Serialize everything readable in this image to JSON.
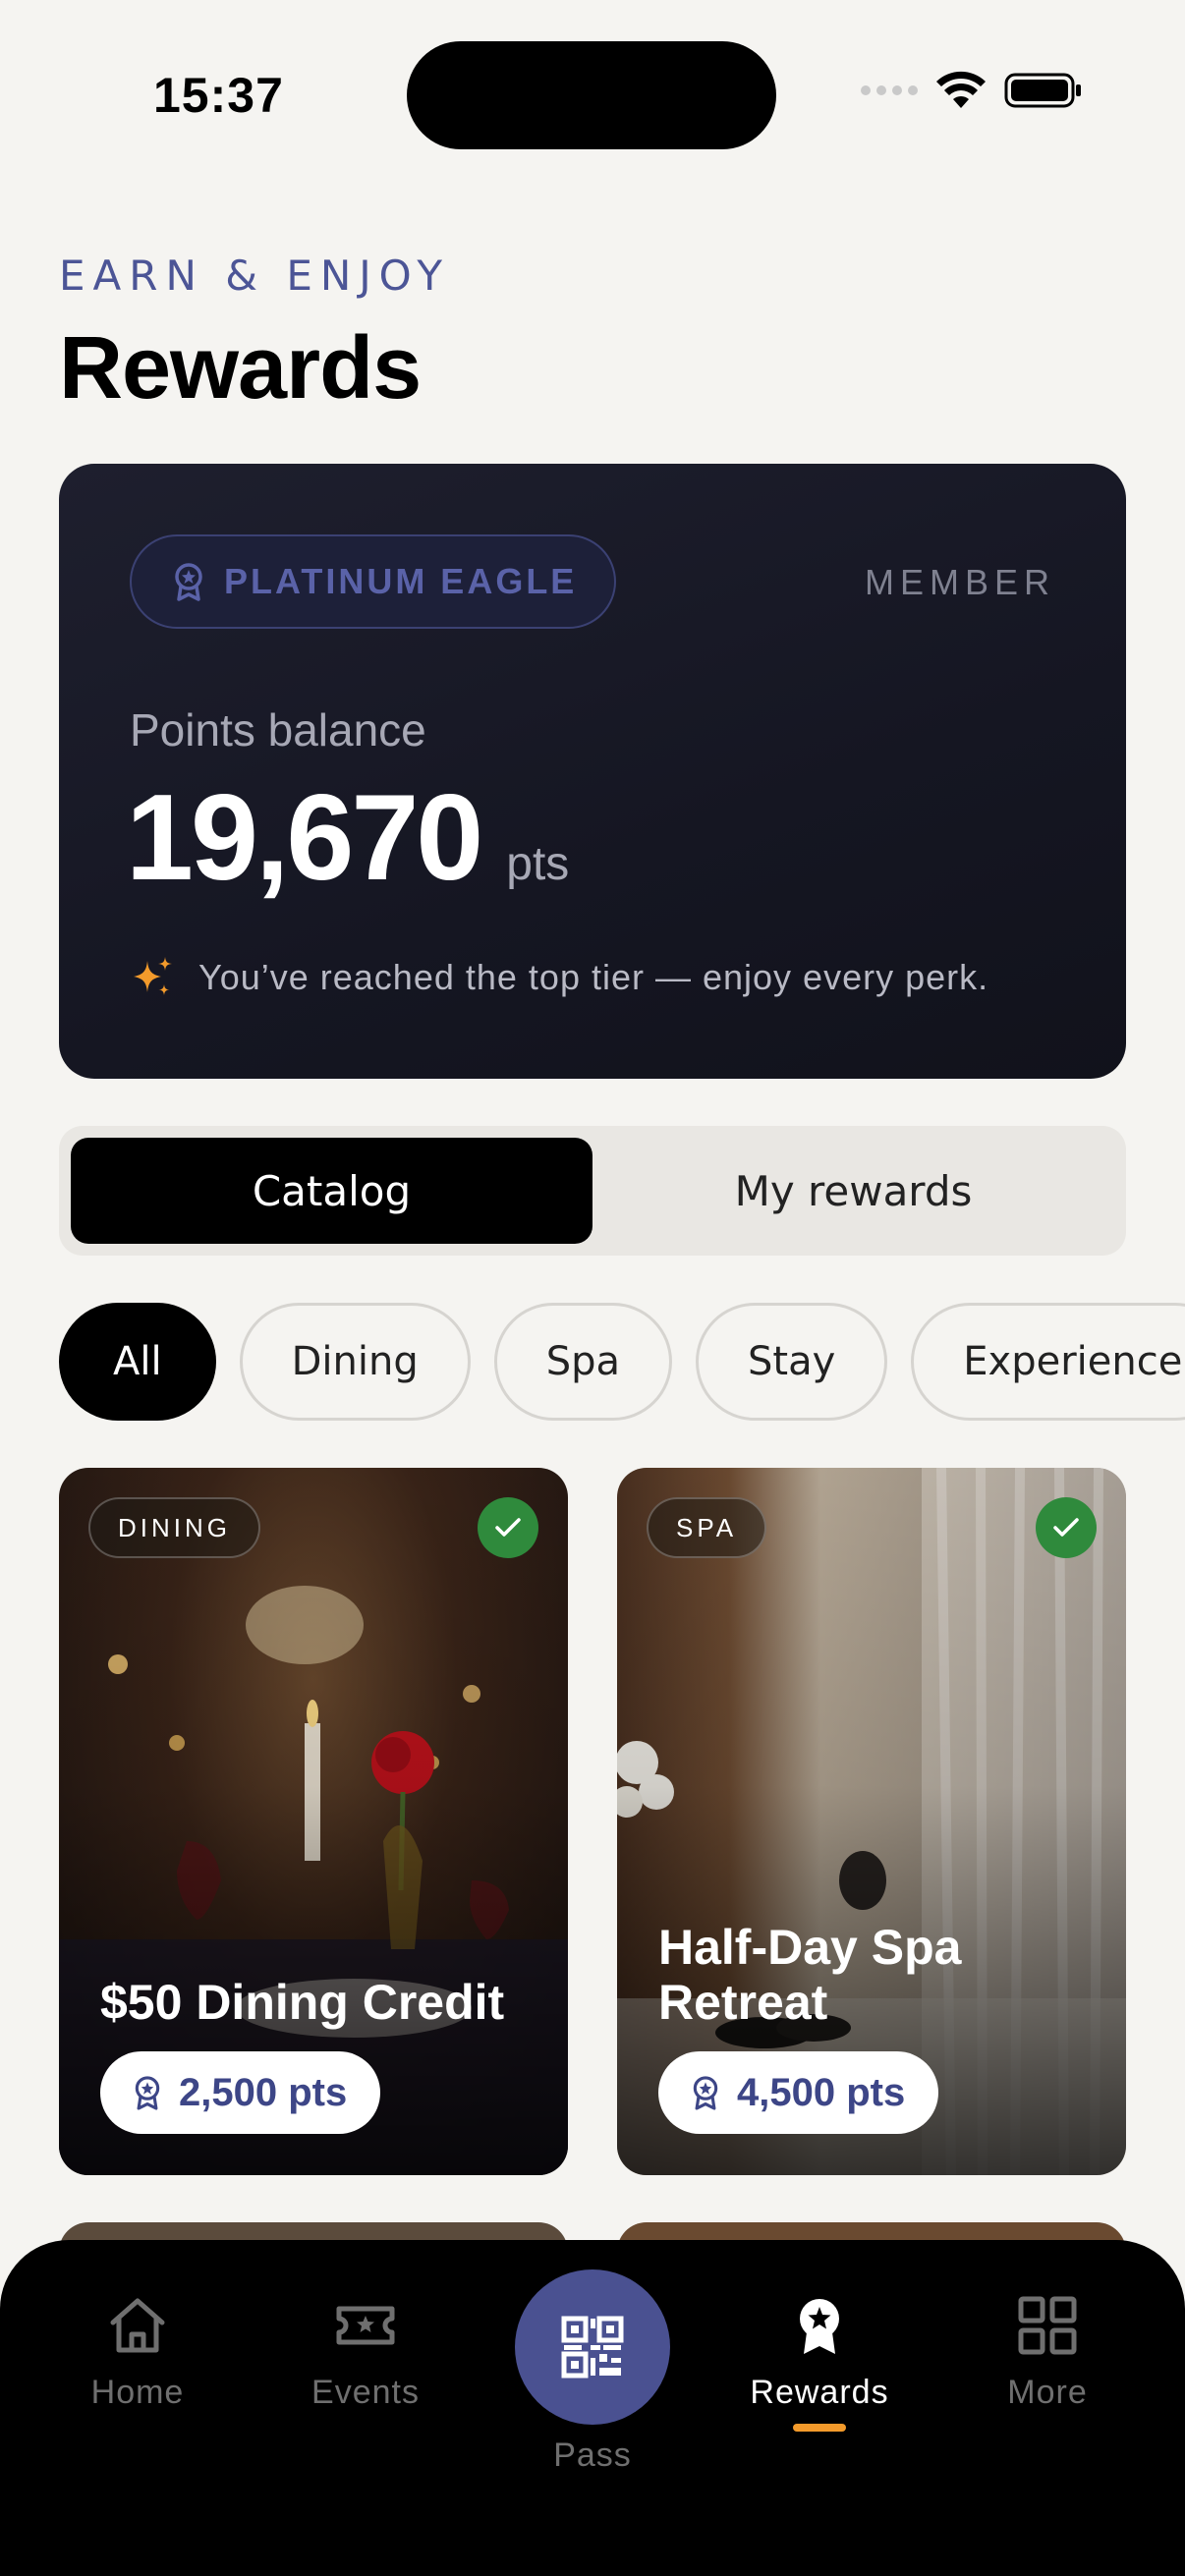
{
  "status_bar": {
    "time": "15:37"
  },
  "header": {
    "eyebrow": "EARN & ENJOY",
    "title": "Rewards"
  },
  "points_card": {
    "tier": "PLATINUM EAGLE",
    "member_label": "MEMBER",
    "balance_label": "Points balance",
    "balance_value": "19,670",
    "balance_unit": "pts",
    "note": "You’ve reached the top tier — enjoy every perk."
  },
  "segmented": {
    "tabs": [
      "Catalog",
      "My rewards"
    ],
    "active": "Catalog"
  },
  "filters": {
    "items": [
      "All",
      "Dining",
      "Spa",
      "Stay",
      "Experience"
    ],
    "active": "All"
  },
  "rewards": [
    {
      "category": "DINING",
      "title": "$50 Dining Credit",
      "points": "2,500 pts",
      "available": true
    },
    {
      "category": "SPA",
      "title": "Half-Day Spa Retreat",
      "points": "4,500 pts",
      "available": true
    }
  ],
  "tabbar": {
    "items": [
      "Home",
      "Events",
      "Pass",
      "Rewards",
      "More"
    ],
    "active": "Rewards"
  },
  "colors": {
    "accent": "#4a5191",
    "active_indicator": "#f39a2b",
    "success": "#2f8a3c",
    "card_bg": "#151622"
  }
}
